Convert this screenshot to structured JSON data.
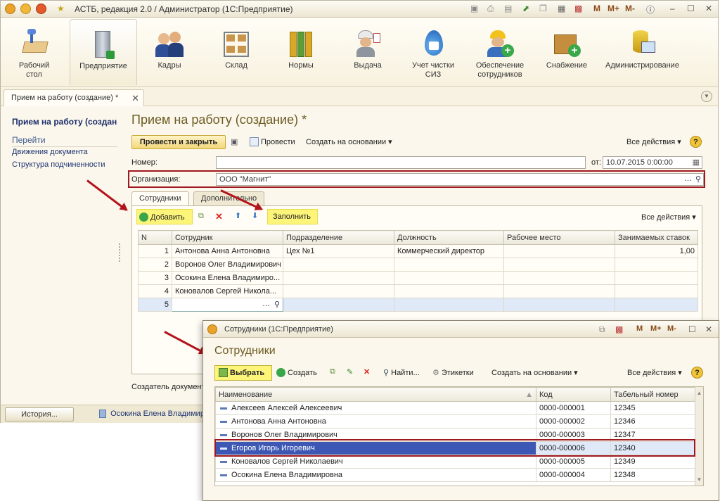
{
  "window": {
    "title": "АСТБ, редакция 2.0 / Администратор  (1С:Предприятие)",
    "controls": [
      "M",
      "M+",
      "M-"
    ]
  },
  "ribbon": {
    "sections": [
      {
        "label": "Рабочий стол",
        "icon": "desktop-icon"
      },
      {
        "label": "Предприятие",
        "icon": "building-icon"
      },
      {
        "label": "Кадры",
        "icon": "people-icon"
      },
      {
        "label": "Склад",
        "icon": "warehouse-icon"
      },
      {
        "label": "Нормы",
        "icon": "binders-icon"
      },
      {
        "label": "Выдача",
        "icon": "worker-icon"
      },
      {
        "label": "Учет чистки СИЗ",
        "icon": "water-drop-icon"
      },
      {
        "label": "Обеспечение сотрудников",
        "icon": "worker-plus-icon"
      },
      {
        "label": "Снабжение",
        "icon": "box-plus-icon"
      },
      {
        "label": "Администрирование",
        "icon": "database-icon"
      }
    ]
  },
  "doc_tab": {
    "label": "Прием на работу (создание) *"
  },
  "left_nav": {
    "current": "Прием на работу (создание) *",
    "goto": "Перейти",
    "links": [
      "Движения документа",
      "Структура подчиненности"
    ]
  },
  "form": {
    "title": "Прием на работу (создание) *",
    "toolbar": {
      "post_close": "Провести и закрыть",
      "post": "Провести",
      "create_based": "Создать на основании",
      "all_actions": "Все действия",
      "help": "?"
    },
    "number_label": "Номер:",
    "number_value": "",
    "date_label": "от:",
    "date_value": "10.07.2015  0:00:00",
    "org_label": "Организация:",
    "org_value": "ООО \"Магнит\"",
    "tabs": [
      "Сотрудники",
      "Дополнительно"
    ],
    "grid_toolbar": {
      "add": "Добавить",
      "fill": "Заполнить",
      "all_actions": "Все действия"
    },
    "columns": [
      "N",
      "Сотрудник",
      "Подразделение",
      "Должность",
      "Рабочее место",
      "Занимаемых ставок"
    ],
    "rows": [
      {
        "n": "1",
        "employee": "Антонова Анна Антоновна",
        "dept": "Цех №1",
        "position": "Коммерческий директор",
        "workplace": "",
        "rate": "1,00"
      },
      {
        "n": "2",
        "employee": "Воронов Олег Владимирович",
        "dept": "",
        "position": "",
        "workplace": "",
        "rate": ""
      },
      {
        "n": "3",
        "employee": "Осокина Елена Владимиро...",
        "dept": "",
        "position": "",
        "workplace": "",
        "rate": ""
      },
      {
        "n": "4",
        "employee": "Коновалов Сергей Никола...",
        "dept": "",
        "position": "",
        "workplace": "",
        "rate": ""
      },
      {
        "n": "5",
        "employee": "",
        "dept": "",
        "position": "",
        "workplace": "",
        "rate": ""
      }
    ],
    "creator_label": "Создатель документ"
  },
  "status": {
    "history": "История...",
    "item": "Осокина Елена Владимировна"
  },
  "popup": {
    "title": "Сотрудники  (1С:Предприятие)",
    "header": "Сотрудники",
    "toolbar": {
      "select": "Выбрать",
      "create": "Создать",
      "find": "Найти...",
      "labels": "Этикетки",
      "create_based": "Создать на основании",
      "all_actions": "Все действия"
    },
    "columns": [
      "Наименование",
      "Код",
      "Табельный номер"
    ],
    "rows": [
      {
        "name": "Алексеев Алексей Алексеевич",
        "code": "0000-000001",
        "tab": "12345"
      },
      {
        "name": "Антонова Анна Антоновна",
        "code": "0000-000002",
        "tab": "12346"
      },
      {
        "name": "Воронов Олег Владимирович",
        "code": "0000-000003",
        "tab": "12347"
      },
      {
        "name": "Егоров Игорь Игоревич",
        "code": "0000-000006",
        "tab": "12340"
      },
      {
        "name": "Коновалов Сергей Николаевич",
        "code": "0000-000005",
        "tab": "12349"
      },
      {
        "name": "Осокина Елена Владимировна",
        "code": "0000-000004",
        "tab": "12348"
      }
    ],
    "selected_index": 3
  },
  "colors": {
    "accent_red": "#a0181f",
    "highlight_yellow": "#fdf57a",
    "selected_row": "#3c58b4"
  }
}
